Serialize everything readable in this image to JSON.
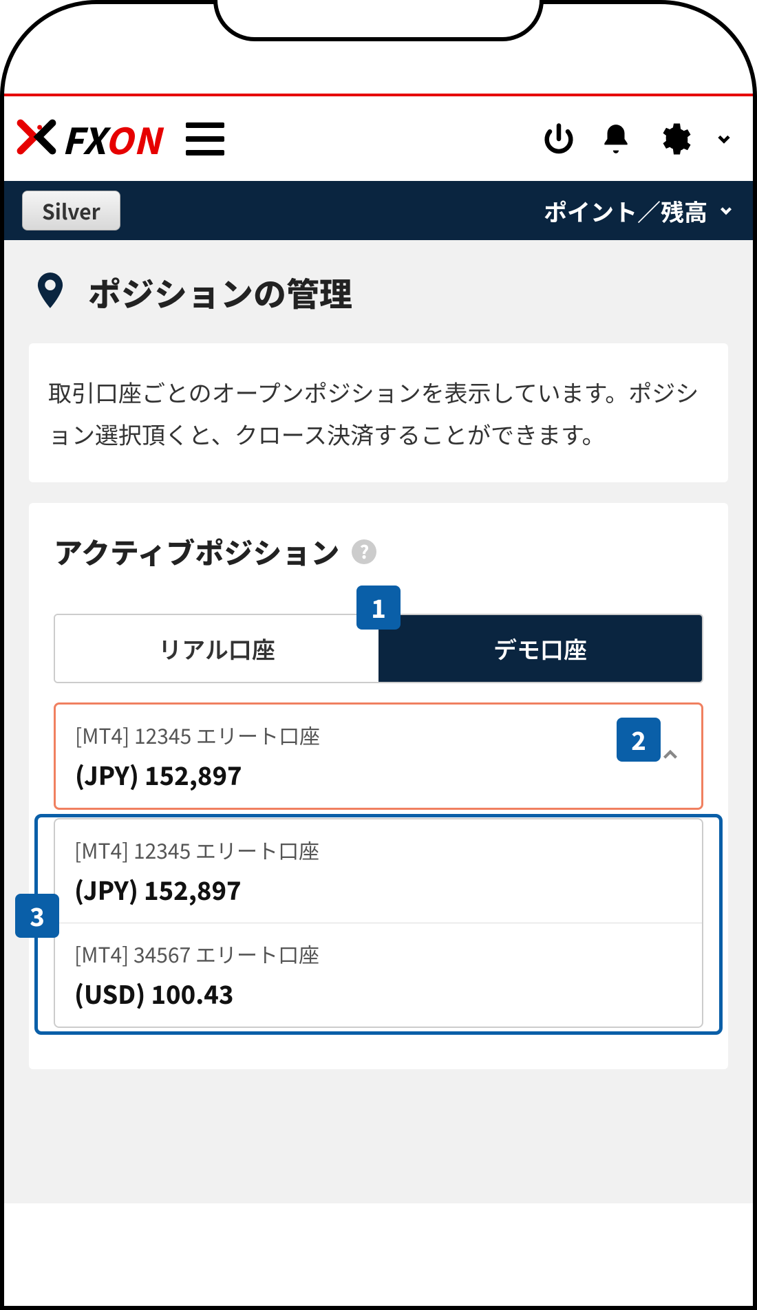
{
  "brand": {
    "name": "FXON"
  },
  "header": {
    "tier_badge": "Silver",
    "points_label": "ポイント／残高"
  },
  "page": {
    "title": "ポジションの管理",
    "description": "取引口座ごとのオープンポジションを表示しています。ポジション選択頂くと、クロース決済することができます。"
  },
  "panel": {
    "title": "アクティブポジション",
    "tab_real": "リアル口座",
    "tab_demo": "デモ口座",
    "selected_account": {
      "label": "[MT4] 12345 エリート口座",
      "balance": "(JPY) 152,897"
    },
    "options": [
      {
        "label": "[MT4] 12345 エリート口座",
        "balance": "(JPY) 152,897"
      },
      {
        "label": "[MT4] 34567 エリート口座",
        "balance": "(USD) 100.43"
      }
    ]
  },
  "callouts": {
    "one": "1",
    "two": "2",
    "three": "3"
  }
}
